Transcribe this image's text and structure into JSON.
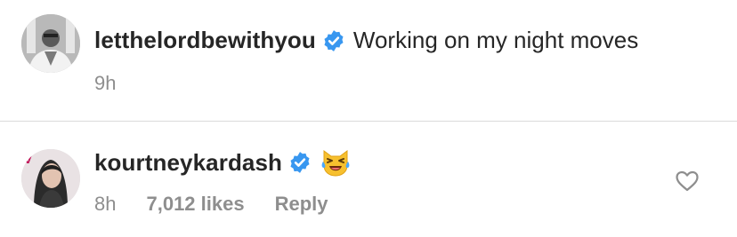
{
  "comments": [
    {
      "username": "letthelordbewithyou",
      "verified": true,
      "text": "Working on my night moves",
      "time": "9h",
      "likes": "",
      "reply": ""
    },
    {
      "username": "kourtneykardash",
      "verified": true,
      "text": "😹",
      "time": "8h",
      "likes": "7,012 likes",
      "reply": "Reply"
    }
  ],
  "colors": {
    "verified_blue": "#3897f0",
    "meta_gray": "#8e8e8e",
    "divider": "#dbdbdb"
  },
  "icons": {
    "verified": "verified-badge-icon",
    "like": "heart-outline-icon"
  }
}
